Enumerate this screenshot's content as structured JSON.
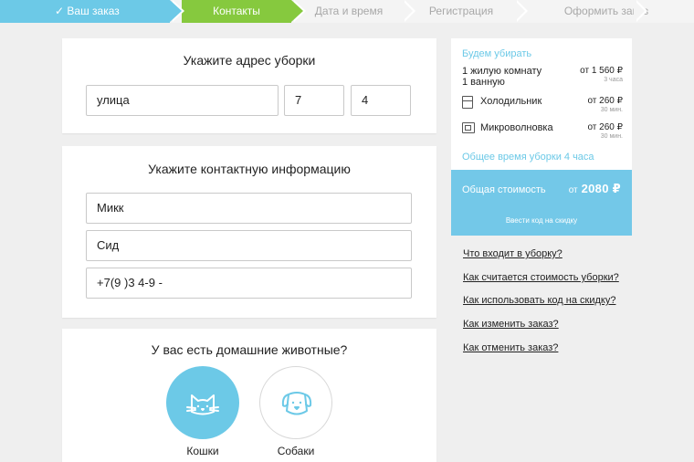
{
  "steps": [
    {
      "label": "✓ Ваш заказ"
    },
    {
      "label": "Контакты"
    },
    {
      "label": "Дата и время"
    },
    {
      "label": "Регистрация"
    },
    {
      "label": "Оформить заказ"
    }
  ],
  "colors": {
    "step_done": "#6cc9e7",
    "step_active": "#86c93e",
    "accent": "#6cc9e7"
  },
  "address": {
    "title": "Укажите адрес уборки",
    "street": "улица ",
    "house": "7",
    "apartment": "4"
  },
  "contact": {
    "title": "Укажите контактную информацию",
    "first_name": "Микк",
    "last_name": "Сид",
    "phone": "+7(9 )3 4-9 -"
  },
  "pets": {
    "title": "У вас есть домашние животные?",
    "cat": {
      "label": "Кошки",
      "icon": "cat-icon",
      "selected": true
    },
    "dog": {
      "label": "Собаки",
      "icon": "dog-icon",
      "selected": false
    }
  },
  "summary": {
    "header": "Будем убирать",
    "rooms_line1": "1 жилую комнату",
    "rooms_line2": "1 ванную",
    "rooms_price": "от 1 560 ₽",
    "rooms_time": "3 часа",
    "items": [
      {
        "name": "Холодильник",
        "icon": "fridge-icon",
        "price": "от 260 ₽",
        "time": "30 мин."
      },
      {
        "name": "Микроволновка",
        "icon": "microwave-icon",
        "price": "от 260 ₽",
        "time": "30 мин."
      }
    ],
    "total_time": "Общее время уборки 4 часа",
    "total_label": "Общая стоимость",
    "total_prefix": "от",
    "total_value": "2080 ₽",
    "promo": "Ввести код на скидку"
  },
  "faq": [
    "Что входит в уборку?",
    "Как считается стоимость уборки?",
    "Как использовать код на скидку?",
    "Как изменить заказ?",
    "Как отменить заказ?"
  ]
}
